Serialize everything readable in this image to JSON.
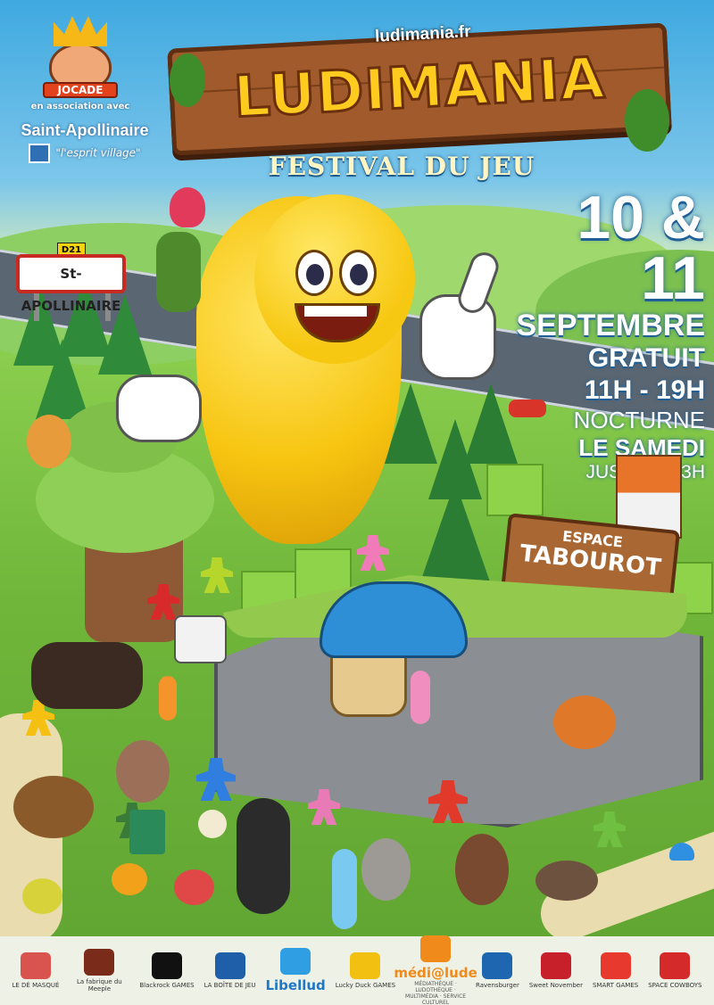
{
  "header": {
    "jocade_label": "JOCADE",
    "association_text": "en association avec",
    "village_name": "Saint-Apollinaire",
    "village_tagline": "\"l'esprit village\""
  },
  "brand": {
    "site_url": "ludimania.fr",
    "name": "LUDIMANIA",
    "subtitle": "FESTIVAL DU JEU"
  },
  "event": {
    "dates": "10 & 11",
    "month": "SEPTEMBRE",
    "price": "GRATUIT",
    "hours": "11H - 19H",
    "nocturne_1": "NOCTURNE",
    "nocturne_2": "LE SAMEDI",
    "nocturne_3": "JUSQU'À 03H"
  },
  "road_sign": {
    "code": "D21",
    "label": "St-APOLLINAIRE"
  },
  "venue_sign": {
    "line1": "ESPACE",
    "line2": "TABOUROT"
  },
  "sponsors": [
    {
      "name": "LE DÉ MASQUÉ",
      "icon": "masked-die-icon",
      "color": "#d9534f"
    },
    {
      "name": "La fabrique du Meeple",
      "icon": "meeple-icon",
      "color": "#7a2b1a"
    },
    {
      "name": "Blackrock GAMES",
      "icon": "blackrock-icon",
      "color": "#111111"
    },
    {
      "name": "LA BOÎTE DE JEU",
      "icon": "boite-icon",
      "color": "#1f5ea8"
    },
    {
      "name": "Libellud",
      "icon": "libellud-icon",
      "color": "#2f9ee3"
    },
    {
      "name": "Lucky Duck GAMES",
      "icon": "duck-icon",
      "color": "#f2c010"
    },
    {
      "name": "médi@lude",
      "sub": "MÉDIATHÈQUE · LUDOTHÈQUE · MULTIMÉDIA · SERVICE CULTUREL",
      "icon": "medialude-icon",
      "color": "#f08a1a"
    },
    {
      "name": "Ravensburger",
      "icon": "ravensburger-icon",
      "color": "#1f66b0"
    },
    {
      "name": "Sweet November",
      "icon": "leaf-icon",
      "color": "#c8202b"
    },
    {
      "name": "SMART GAMES",
      "icon": "smartgames-icon",
      "color": "#e8392e"
    },
    {
      "name": "SPACE COWBOYS",
      "icon": "space-cowboys-icon",
      "color": "#d42a2a"
    }
  ]
}
